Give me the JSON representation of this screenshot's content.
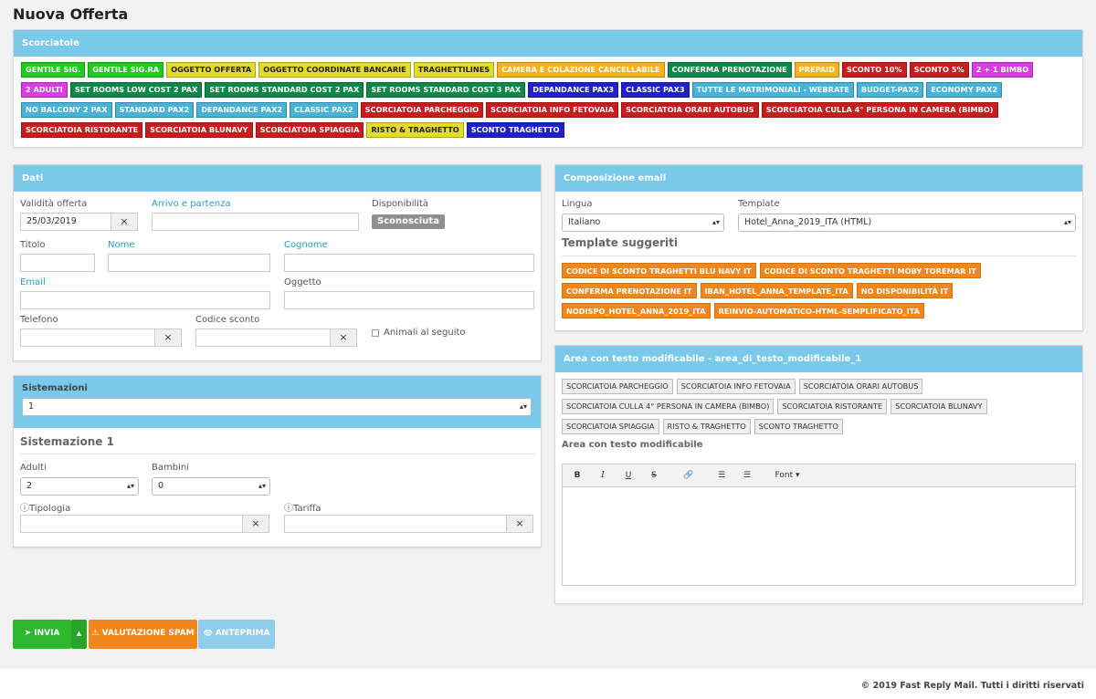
{
  "page_title": "Nuova Offerta",
  "scorciatoie": {
    "title": "Scorciatoie",
    "chips": [
      {
        "label": "GENTILE SIG.",
        "color": "green"
      },
      {
        "label": "GENTILE SIG.RA",
        "color": "green"
      },
      {
        "label": "OGGETTO OFFERTA",
        "color": "yellow"
      },
      {
        "label": "OGGETTO COORDINATE BANCARIE",
        "color": "yellow"
      },
      {
        "label": "TRAGHETTILINES",
        "color": "yellow"
      },
      {
        "label": "CAMERA E COLAZIONE CANCELLABILE",
        "color": "orange"
      },
      {
        "label": "CONFERMA PRENOTAZIONE",
        "color": "dgreen"
      },
      {
        "label": "PREPAID",
        "color": "orange"
      },
      {
        "label": "SCONTO 10%",
        "color": "red"
      },
      {
        "label": "SCONTO 5%",
        "color": "red"
      },
      {
        "label": "2 + 1 BIMBO",
        "color": "pink"
      },
      {
        "label": "2 ADULTI",
        "color": "pink"
      },
      {
        "label": "SET ROOMS LOW COST 2 PAX",
        "color": "dgreen"
      },
      {
        "label": "SET ROOMS STANDARD COST 2 PAX",
        "color": "dgreen"
      },
      {
        "label": "SET ROOMS STANDARD COST 3 PAX",
        "color": "dgreen"
      },
      {
        "label": "DEPANDANCE PAX3",
        "color": "navy"
      },
      {
        "label": "CLASSIC PAX3",
        "color": "navy"
      },
      {
        "label": "TUTTE LE MATRIMONIALI - WEBRATE",
        "color": "lblue"
      },
      {
        "label": "BUDGET-PAX2",
        "color": "lblue"
      },
      {
        "label": "ECONOMY PAX2",
        "color": "lblue"
      },
      {
        "label": "NO BALCONY 2 PAX",
        "color": "lblue"
      },
      {
        "label": "STANDARD PAX2",
        "color": "lblue"
      },
      {
        "label": "DEPANDANCE PAX2",
        "color": "lblue"
      },
      {
        "label": "CLASSIC PAX2",
        "color": "lblue"
      },
      {
        "label": "SCORCIATOIA PARCHEGGIO",
        "color": "red"
      },
      {
        "label": "SCORCIATOIA INFO FETOVAIA",
        "color": "red"
      },
      {
        "label": "SCORCIATOIA ORARI AUTOBUS",
        "color": "red"
      },
      {
        "label": "SCORCIATOIA CULLA 4° PERSONA IN CAMERA (BIMBO)",
        "color": "red"
      },
      {
        "label": "SCORCIATOIA RISTORANTE",
        "color": "red"
      },
      {
        "label": "SCORCIATOIA BLUNAVY",
        "color": "red"
      },
      {
        "label": "SCORCIATOIA SPIAGGIA",
        "color": "red"
      },
      {
        "label": "RISTO & TRAGHETTO",
        "color": "yellow"
      },
      {
        "label": "SCONTO TRAGHETTO",
        "color": "navy"
      }
    ]
  },
  "dati": {
    "title": "Dati",
    "validita_label": "Validità offerta",
    "validita_value": "25/03/2019",
    "arrivo_label": "Arrivo e partenza",
    "disponibilita_label": "Disponibilità",
    "disponibilita_value": "Sconosciuta",
    "titolo_label": "Titolo",
    "nome_label": "Nome",
    "cognome_label": "Cognome",
    "email_label": "Email",
    "oggetto_label": "Oggetto",
    "telefono_label": "Telefono",
    "codice_sconto_label": "Codice sconto",
    "animali_label": "Animali al seguito",
    "clear_symbol": "×"
  },
  "sistemazioni": {
    "title": "Sistemazioni",
    "count_value": "1",
    "section_title": "Sistemazione 1",
    "adulti_label": "Adulti",
    "adulti_value": "2",
    "bambini_label": "Bambini",
    "bambini_value": "0",
    "tipologia_label": "Tipologia",
    "tariffa_label": "Tariffa",
    "info_icon": "ⓘ"
  },
  "composizione": {
    "title": "Composizione email",
    "lingua_label": "Lingua",
    "lingua_value": "Italiano",
    "template_label": "Template",
    "template_value": "Hotel_Anna_2019_ITA (HTML)",
    "suggeriti_title": "Template suggeriti",
    "suggeriti": [
      "CODICE DI SCONTO TRAGHETTI BLU NAVY IT",
      "CODICE DI SCONTO TRAGHETTI MOBY TOREMAR IT",
      "CONFERMA PRENOTAZIONE IT",
      "IBAN_HOTEL_ANNA_TEMPLATE_ITA",
      "NO DISPONIBILITÀ IT",
      "NODISPO_HOTEL_ANNA_2019_ITA",
      "REINVIO-AUTOMATICO-HTML-SEMPLIFICATO_ITA"
    ]
  },
  "area": {
    "title": "Area con testo modificabile - area_di_testo_modificabile_1",
    "chips": [
      "SCORCIATOIA PARCHEGGIO",
      "SCORCIATOIA INFO FETOVAIA",
      "SCORCIATOIA ORARI AUTOBUS",
      "SCORCIATOIA CULLA 4° PERSONA IN CAMERA (BIMBO)",
      "SCORCIATOIA RISTORANTE",
      "SCORCIATOIA BLUNAVY",
      "SCORCIATOIA SPIAGGIA",
      "RISTO & TRAGHETTO",
      "SCONTO TRAGHETTO"
    ],
    "editor_label": "Area con testo modificabile",
    "toolbar": {
      "bold": "B",
      "italic": "I",
      "underline": "U",
      "strike": "S",
      "link": "🔗",
      "ul": "☰",
      "ol": "☰",
      "font": "Font ▾"
    }
  },
  "actions": {
    "invia": "INVIA",
    "caret": "▲",
    "spam": "VALUTAZIONE SPAM",
    "anteprima": "ANTEPRIMA",
    "send_icon": "➤",
    "warn_icon": "⚠",
    "eye_icon": "👁"
  },
  "colors": {
    "panel_header": "#7ac9ea",
    "invia": "#2fb82f",
    "spam": "#f0861c",
    "anteprima": "#8fcdea"
  },
  "footer": "© 2019 Fast Reply Mail. Tutti i diritti riservati"
}
